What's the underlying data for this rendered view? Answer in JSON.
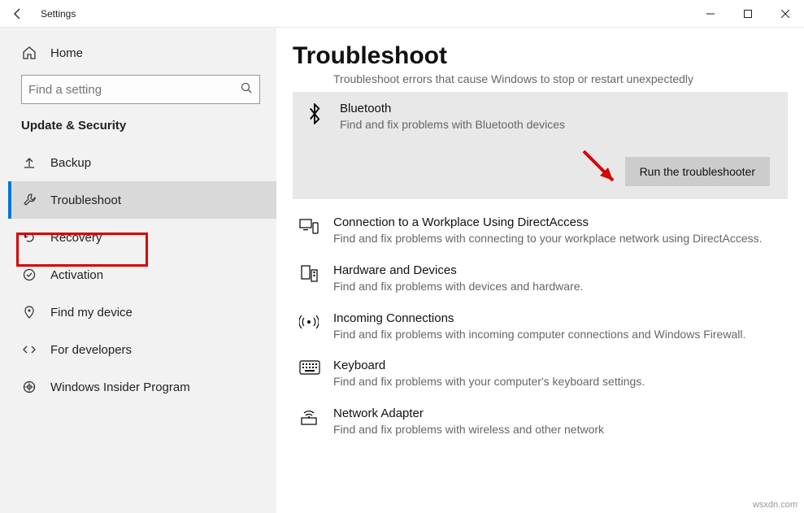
{
  "titlebar": {
    "title": "Settings"
  },
  "sidebar": {
    "home_label": "Home",
    "search_placeholder": "Find a setting",
    "section_header": "Update & Security",
    "items": [
      {
        "label": "Backup"
      },
      {
        "label": "Troubleshoot"
      },
      {
        "label": "Recovery"
      },
      {
        "label": "Activation"
      },
      {
        "label": "Find my device"
      },
      {
        "label": "For developers"
      },
      {
        "label": "Windows Insider Program"
      }
    ]
  },
  "main": {
    "page_title": "Troubleshoot",
    "truncated_first_desc": "Troubleshoot errors that cause Windows to stop or restart unexpectedly",
    "expanded": {
      "title": "Bluetooth",
      "desc": "Find and fix problems with Bluetooth devices",
      "run_label": "Run the troubleshooter"
    },
    "items": [
      {
        "title": "Connection to a Workplace Using DirectAccess",
        "desc": "Find and fix problems with connecting to your workplace network using DirectAccess."
      },
      {
        "title": "Hardware and Devices",
        "desc": "Find and fix problems with devices and hardware."
      },
      {
        "title": "Incoming Connections",
        "desc": "Find and fix problems with incoming computer connections and Windows Firewall."
      },
      {
        "title": "Keyboard",
        "desc": "Find and fix problems with your computer's keyboard settings."
      },
      {
        "title": "Network Adapter",
        "desc": "Find and fix problems with wireless and other network"
      }
    ]
  },
  "watermark": "wsxdn.com"
}
